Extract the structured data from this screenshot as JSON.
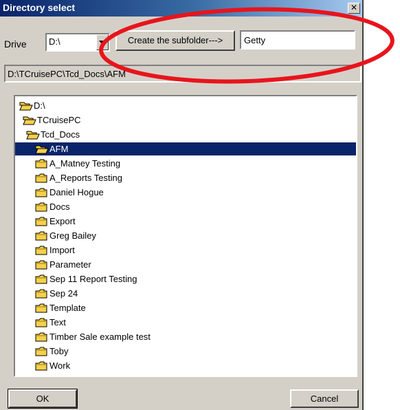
{
  "window": {
    "title": "Directory select",
    "close_glyph": "✕"
  },
  "drive": {
    "label": "Drive",
    "value": "D:\\"
  },
  "create_button": {
    "label": "Create the subfolder--->"
  },
  "subfolder_input": {
    "value": "Getty"
  },
  "current_path": "D:\\TCruisePC\\Tcd_Docs\\AFM",
  "tree": {
    "selected_index": 3,
    "items": [
      {
        "label": "D:\\",
        "level": 0,
        "icon": "open-folder-icon"
      },
      {
        "label": "TCruisePC",
        "level": 1,
        "icon": "open-folder-icon"
      },
      {
        "label": "Tcd_Docs",
        "level": 2,
        "icon": "open-folder-icon"
      },
      {
        "label": "AFM",
        "level": 3,
        "icon": "open-folder-icon"
      },
      {
        "label": "A_Matney Testing",
        "level": 3,
        "icon": "folder-icon"
      },
      {
        "label": "A_Reports Testing",
        "level": 3,
        "icon": "folder-icon"
      },
      {
        "label": "Daniel Hogue",
        "level": 3,
        "icon": "folder-icon"
      },
      {
        "label": "Docs",
        "level": 3,
        "icon": "folder-icon"
      },
      {
        "label": "Export",
        "level": 3,
        "icon": "folder-icon"
      },
      {
        "label": "Greg Bailey",
        "level": 3,
        "icon": "folder-icon"
      },
      {
        "label": "Import",
        "level": 3,
        "icon": "folder-icon"
      },
      {
        "label": "Parameter",
        "level": 3,
        "icon": "folder-icon"
      },
      {
        "label": "Sep 11 Report Testing",
        "level": 3,
        "icon": "folder-icon"
      },
      {
        "label": "Sep 24",
        "level": 3,
        "icon": "folder-icon"
      },
      {
        "label": "Template",
        "level": 3,
        "icon": "folder-icon"
      },
      {
        "label": "Text",
        "level": 3,
        "icon": "folder-icon"
      },
      {
        "label": "Timber Sale example test",
        "level": 3,
        "icon": "folder-icon"
      },
      {
        "label": "Toby",
        "level": 3,
        "icon": "folder-icon"
      },
      {
        "label": "Work",
        "level": 3,
        "icon": "folder-icon"
      }
    ]
  },
  "buttons": {
    "ok": "OK",
    "cancel": "Cancel"
  },
  "colors": {
    "titlebar": "#0a246a",
    "selection": "#0a246a",
    "face": "#d4d0c8",
    "folder": "#f5d04a",
    "annotation": "#e8141c"
  },
  "annotation": {
    "shape": "ellipse",
    "color": "#e8141c",
    "target": "create-subfolder-controls"
  }
}
